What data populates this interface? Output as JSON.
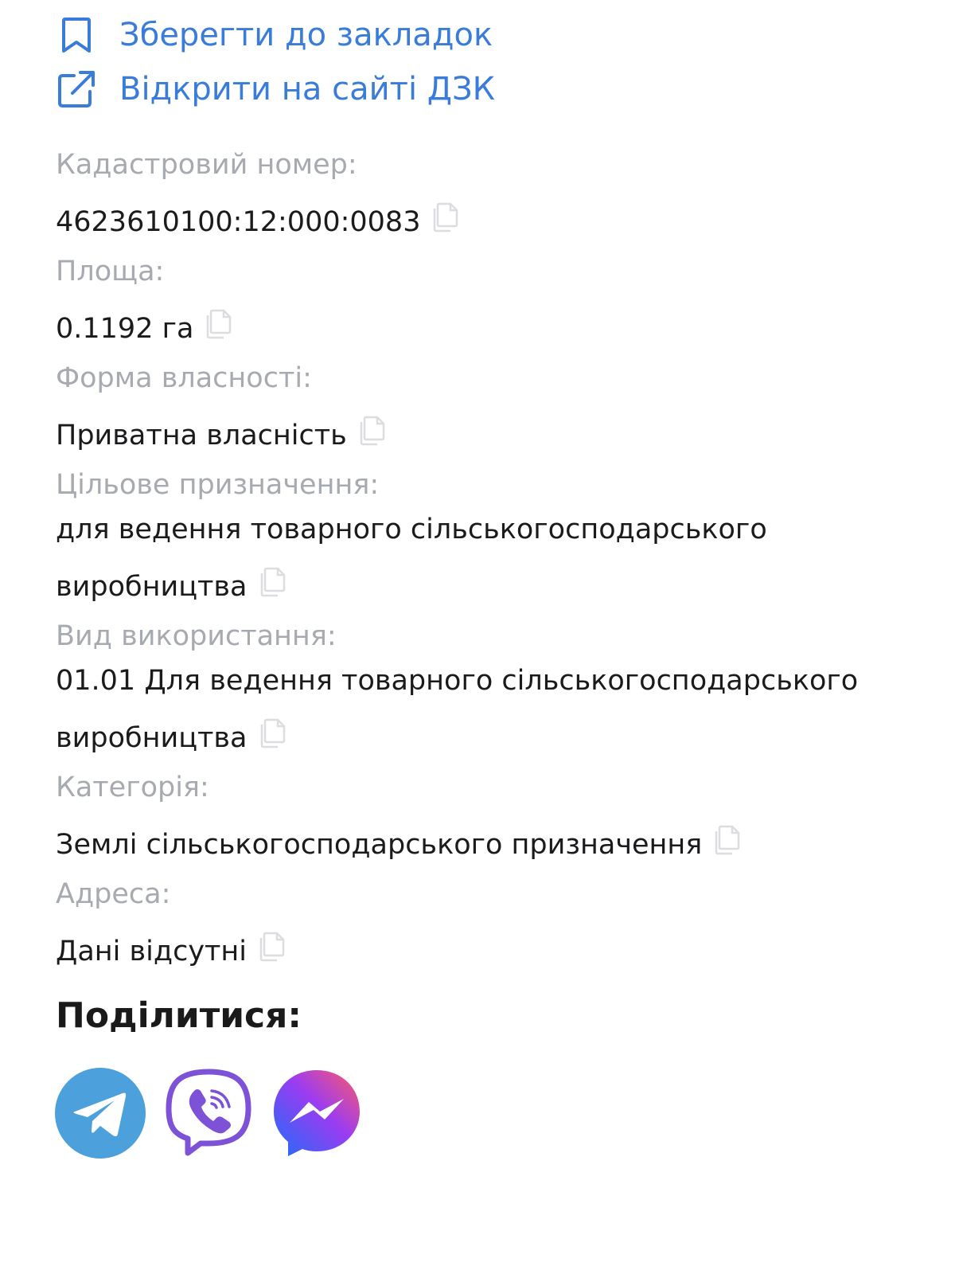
{
  "actions": {
    "bookmark_label": "Зберегти до закладок",
    "open_dzk_label": "Відкрити на сайті ДЗК"
  },
  "fields": [
    {
      "label": "Кадастровий номер:",
      "value": "4623610100:12:000:0083"
    },
    {
      "label": "Площа:",
      "value": "0.1192 га"
    },
    {
      "label": "Форма власності:",
      "value": "Приватна власність"
    },
    {
      "label": "Цільове призначення:",
      "value_line1": "для ведення товарного сільськогосподарського",
      "value_line2": "виробництва"
    },
    {
      "label": "Вид використання:",
      "value_line1": "01.01 Для ведення товарного сільськогосподарського",
      "value_line2": "виробництва"
    },
    {
      "label": "Категорія:",
      "value": "Землі сільськогосподарського призначення"
    },
    {
      "label": "Адреса:",
      "value": "Дані відсутні"
    }
  ],
  "share": {
    "title": "Поділитися:",
    "buttons": [
      {
        "name": "telegram",
        "icon": "telegram-icon",
        "color": "#4ca0dc"
      },
      {
        "name": "viber",
        "icon": "viber-icon",
        "color": "#7d52d6"
      },
      {
        "name": "messenger",
        "icon": "messenger-icon",
        "color": "#7b46f0"
      }
    ]
  },
  "colors": {
    "link": "#3a7cd9",
    "label": "#a7aab0",
    "value": "#1b1b1d",
    "copy_icon": "#dcdde0"
  }
}
